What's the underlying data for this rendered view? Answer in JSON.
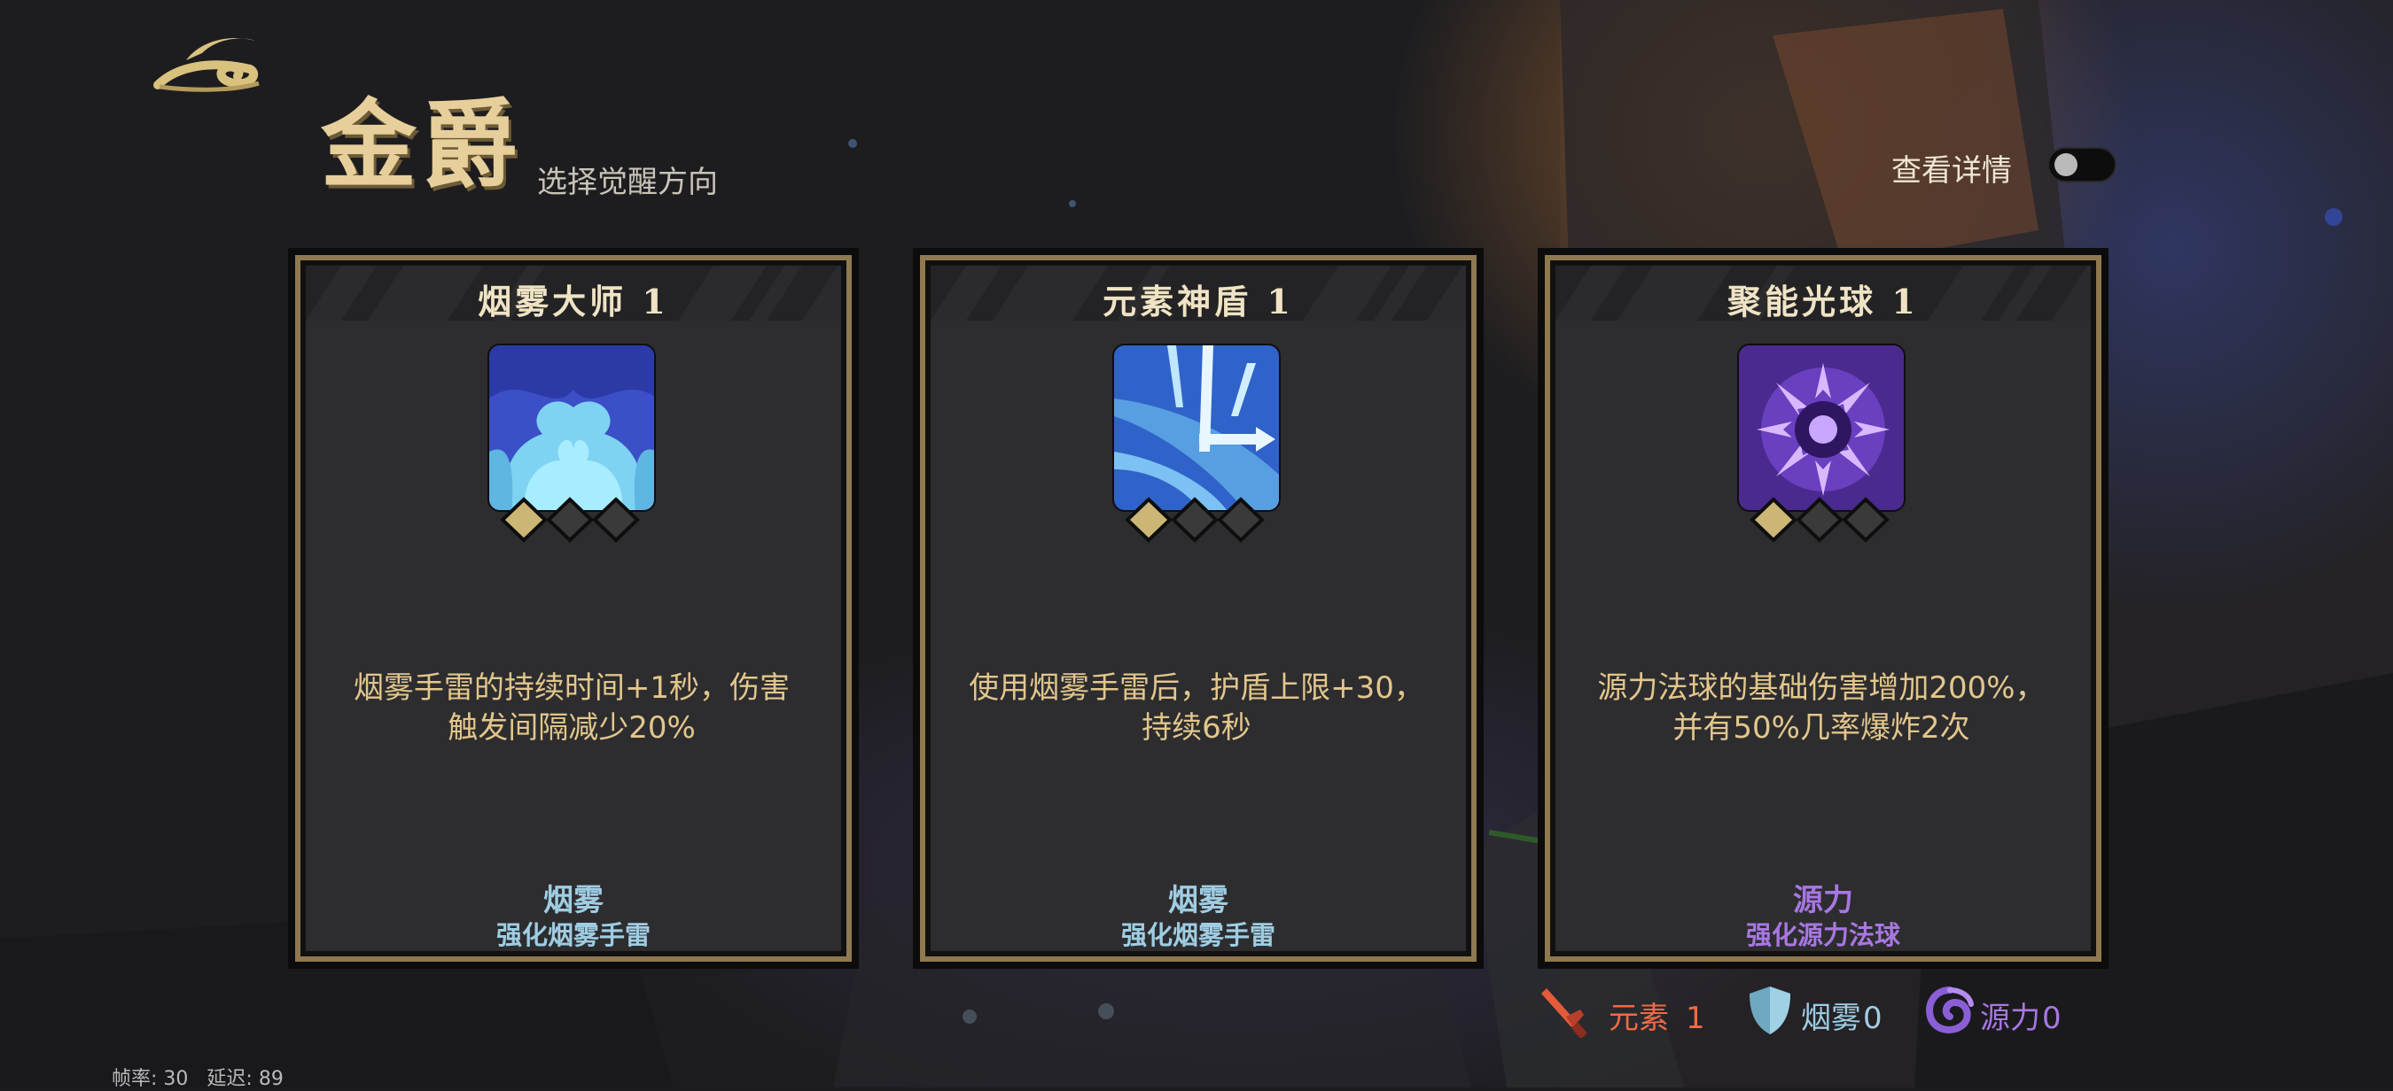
{
  "header": {
    "title": "金爵",
    "subtitle": "选择觉醒方向",
    "detail_label": "查看详情",
    "detail_toggle_on": false
  },
  "cards": [
    {
      "name": "烟雾大师 1",
      "icon": "smoke-master-icon",
      "level": 1,
      "max_level": 3,
      "description": "烟雾手雷的持续时间+1秒，伤害\n触发间隔减少20%",
      "category": "烟雾",
      "sub_category": "强化烟雾手雷",
      "category_color": "#9fcde3"
    },
    {
      "name": "元素神盾 1",
      "icon": "element-shield-icon",
      "level": 1,
      "max_level": 3,
      "description": "使用烟雾手雷后，护盾上限+30，\n持续6秒",
      "category": "烟雾",
      "sub_category": "强化烟雾手雷",
      "category_color": "#9fcde3"
    },
    {
      "name": "聚能光球 1",
      "icon": "energy-orb-icon",
      "level": 1,
      "max_level": 3,
      "description": "源力法球的基础伤害增加200%，\n并有50%几率爆炸2次",
      "category": "源力",
      "sub_category": "强化源力法球",
      "category_color": "#a877e2"
    }
  ],
  "resources": [
    {
      "icon": "dagger-icon",
      "label": "元素",
      "value": "1",
      "color": "#ee6b45"
    },
    {
      "icon": "shield-icon",
      "label": "烟雾",
      "value": "0",
      "color": "#9fcde3"
    },
    {
      "icon": "swirl-icon",
      "label": "源力",
      "value": "0",
      "color": "#a877e2"
    }
  ],
  "status": {
    "fps_label": "帧率:",
    "fps": "30",
    "latency_label": "延迟:",
    "latency": "89"
  },
  "colors": {
    "gold": "#8f7950",
    "title": "#e6cf9a",
    "description": "#e2c68c"
  }
}
